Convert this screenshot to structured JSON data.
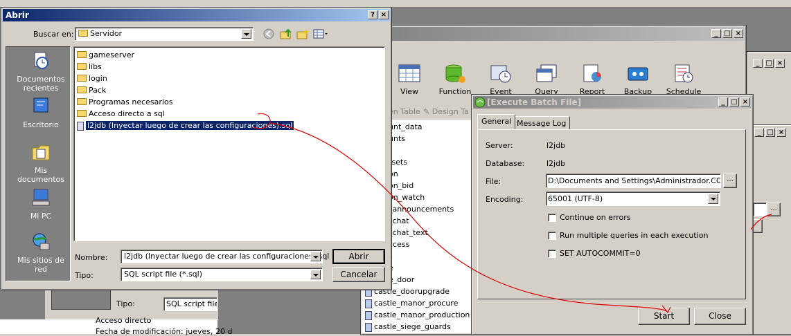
{
  "bg_window": {
    "toolbar": [
      "View",
      "Function",
      "Event",
      "Query",
      "Report",
      "Backup",
      "Schedule"
    ],
    "tabs": [
      "en Table",
      "Design Ta"
    ],
    "tables": [
      "unt_data",
      "unts",
      "r",
      "rsets",
      "on",
      "on_bid",
      "on_watch",
      "_announcements",
      "_chat",
      "_chat_text",
      "ccess",
      "s",
      "e",
      "e_door",
      "castle_doorupgrade",
      "castle_manor_procure",
      "castle_manor_production",
      "castle_siege_guards"
    ],
    "tipo_label": "Tipo:",
    "tipo_value": "SQL script file (*",
    "info": [
      "Acceso directo",
      "Fecha de modificación: jueves, 20 d"
    ]
  },
  "open_dialog": {
    "title": "Abrir",
    "help": "?",
    "close": "×",
    "look_in_label": "Buscar en:",
    "look_in_value": "Servidor",
    "places": [
      "Documentos recientes",
      "Escritorio",
      "Mis documentos",
      "Mi PC",
      "Mis sitios de red"
    ],
    "files": [
      {
        "name": "gameserver",
        "type": "folder"
      },
      {
        "name": "libs",
        "type": "folder"
      },
      {
        "name": "login",
        "type": "folder"
      },
      {
        "name": "Pack",
        "type": "folder"
      },
      {
        "name": "Programas necesarios",
        "type": "folder"
      },
      {
        "name": "Acceso directo a sql",
        "type": "folder"
      },
      {
        "name": "l2jdb (Inyectar luego de crear las configuraciones).sql",
        "type": "file"
      }
    ],
    "name_label": "Nombre:",
    "name_value": "l2jdb (Inyectar luego de crear las configuraciones).sql",
    "type_label": "Tipo:",
    "type_value": "SQL script file (*.sql)",
    "open_button": "Abrir",
    "cancel_button": "Cancelar"
  },
  "batch_dialog": {
    "title": "[Execute Batch File]",
    "tabs": [
      "General",
      "Message Log"
    ],
    "server_label": "Server:",
    "server_value": "l2jdb",
    "database_label": "Database:",
    "database_value": "l2jdb",
    "file_label": "File:",
    "file_value": "D:\\Documents and Settings\\Administrador.CORTAN",
    "browse": "...",
    "encoding_label": "Encoding:",
    "encoding_value": "65001 (UTF-8)",
    "options": [
      "Continue on errors",
      "Run multiple queries in each execution",
      "SET AUTOCOMMIT=0"
    ],
    "start_button": "Start",
    "close_button": "Close"
  },
  "colors": {
    "active_title": "#0a246a",
    "selection": "#0a246a",
    "annotation": "#e00000"
  }
}
